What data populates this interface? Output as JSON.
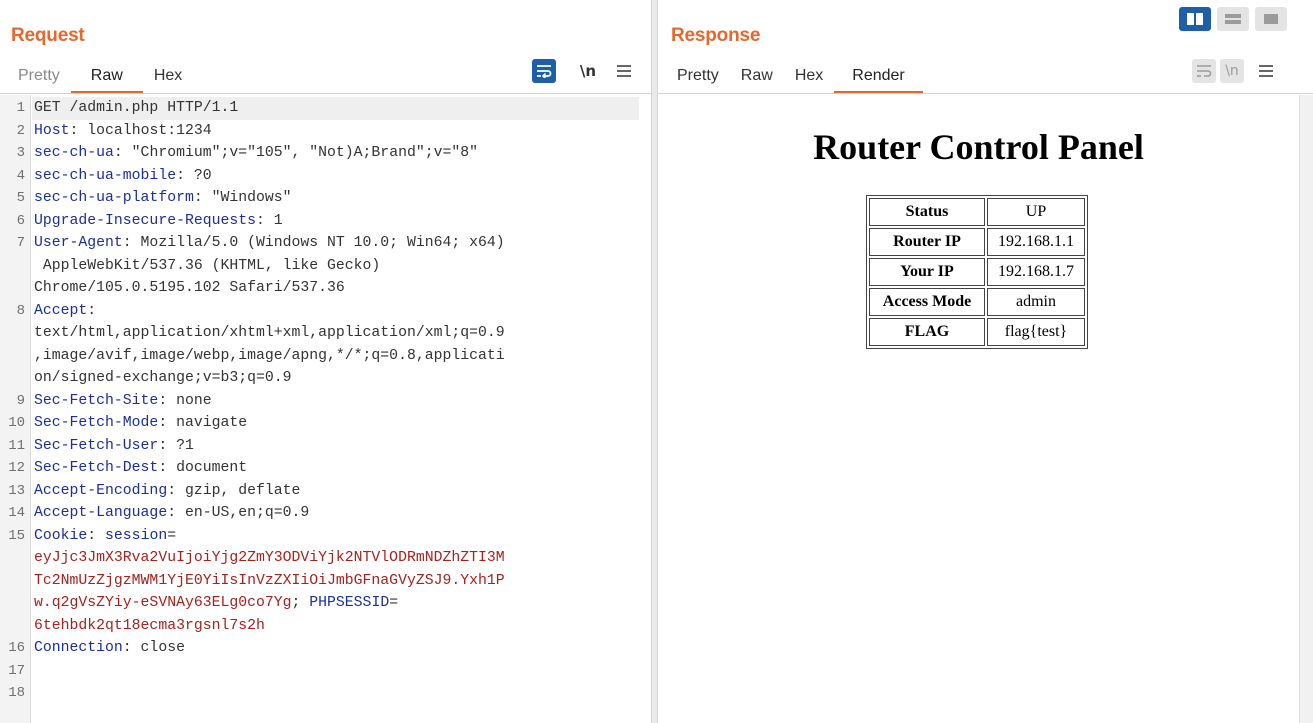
{
  "request": {
    "title": "Request",
    "tabs": [
      "Pretty",
      "Raw",
      "Hex"
    ],
    "active_tab": "Raw",
    "tools": {
      "wrap": "wrap-lines-icon",
      "newline": "\\n",
      "menu": "menu-icon"
    },
    "lines": [
      {
        "n": "1",
        "rows": [
          [
            [
              "p",
              "GET /admin.php HTTP/1.1"
            ]
          ]
        ],
        "current": true
      },
      {
        "n": "2",
        "rows": [
          [
            [
              "h",
              "Host"
            ],
            [
              "p",
              ": localhost:1234"
            ]
          ]
        ]
      },
      {
        "n": "3",
        "rows": [
          [
            [
              "h",
              "sec-ch-ua"
            ],
            [
              "p",
              ": \"Chromium\";v=\"105\", \"Not)A;Brand\";v=\"8\""
            ]
          ]
        ]
      },
      {
        "n": "4",
        "rows": [
          [
            [
              "h",
              "sec-ch-ua-mobile"
            ],
            [
              "p",
              ": ?0"
            ]
          ]
        ]
      },
      {
        "n": "5",
        "rows": [
          [
            [
              "h",
              "sec-ch-ua-platform"
            ],
            [
              "p",
              ": \"Windows\""
            ]
          ]
        ]
      },
      {
        "n": "6",
        "rows": [
          [
            [
              "h",
              "Upgrade-Insecure-Requests"
            ],
            [
              "p",
              ": 1"
            ]
          ]
        ]
      },
      {
        "n": "7",
        "rows": [
          [
            [
              "h",
              "User-Agent"
            ],
            [
              "p",
              ": Mozilla/5.0 (Windows NT 10.0; Win64; x64)"
            ]
          ],
          [
            [
              "p",
              " AppleWebKit/537.36 (KHTML, like Gecko)"
            ]
          ],
          [
            [
              "p",
              "Chrome/105.0.5195.102 Safari/537.36"
            ]
          ]
        ]
      },
      {
        "n": "8",
        "rows": [
          [
            [
              "h",
              "Accept"
            ],
            [
              "p",
              ":"
            ]
          ],
          [
            [
              "p",
              "text/html,application/xhtml+xml,application/xml;q=0.9"
            ]
          ],
          [
            [
              "p",
              ",image/avif,image/webp,image/apng,*/*;q=0.8,applicati"
            ]
          ],
          [
            [
              "p",
              "on/signed-exchange;v=b3;q=0.9"
            ]
          ]
        ]
      },
      {
        "n": "9",
        "rows": [
          [
            [
              "h",
              "Sec-Fetch-Site"
            ],
            [
              "p",
              ": none"
            ]
          ]
        ]
      },
      {
        "n": "10",
        "rows": [
          [
            [
              "h",
              "Sec-Fetch-Mode"
            ],
            [
              "p",
              ": navigate"
            ]
          ]
        ]
      },
      {
        "n": "11",
        "rows": [
          [
            [
              "h",
              "Sec-Fetch-User"
            ],
            [
              "p",
              ": ?1"
            ]
          ]
        ]
      },
      {
        "n": "12",
        "rows": [
          [
            [
              "h",
              "Sec-Fetch-Dest"
            ],
            [
              "p",
              ": document"
            ]
          ]
        ]
      },
      {
        "n": "13",
        "rows": [
          [
            [
              "h",
              "Accept-Encoding"
            ],
            [
              "p",
              ": gzip, deflate"
            ]
          ]
        ]
      },
      {
        "n": "14",
        "rows": [
          [
            [
              "h",
              "Accept-Language"
            ],
            [
              "p",
              ": en-US,en;q=0.9"
            ]
          ]
        ]
      },
      {
        "n": "15",
        "rows": [
          [
            [
              "h",
              "Cookie"
            ],
            [
              "p",
              ": "
            ],
            [
              "h",
              "session"
            ],
            [
              "p",
              "="
            ]
          ],
          [
            [
              "c",
              "eyJjc3JmX3Rva2VuIjoiYjg2ZmY3ODViYjk2NTVlODRmNDZhZTI3M"
            ]
          ],
          [
            [
              "c",
              "Tc2NmUzZjgzMWM1YjE0YiIsInVzZXIiOiJmbGFnaGVyZSJ9.Yxh1P"
            ]
          ],
          [
            [
              "c",
              "w.q2gVsZYiy-eSVNAy63ELg0co7Yg"
            ],
            [
              "p",
              "; "
            ],
            [
              "h",
              "PHPSESSID"
            ],
            [
              "p",
              "="
            ]
          ],
          [
            [
              "c",
              "6tehbdk2qt18ecma3rgsnl7s2h"
            ]
          ]
        ]
      },
      {
        "n": "16",
        "rows": [
          [
            [
              "h",
              "Connection"
            ],
            [
              "p",
              ": close"
            ]
          ]
        ]
      },
      {
        "n": "17",
        "rows": [
          [
            [
              "p",
              ""
            ]
          ]
        ]
      },
      {
        "n": "18",
        "rows": [
          [
            [
              "p",
              ""
            ]
          ]
        ]
      }
    ]
  },
  "response": {
    "title": "Response",
    "tabs": [
      "Pretty",
      "Raw",
      "Hex",
      "Render"
    ],
    "active_tab": "Render",
    "tools": {
      "wrap": "wrap-lines-icon",
      "newline": "\\n",
      "menu": "menu-icon"
    },
    "render": {
      "heading": "Router Control Panel",
      "rows": [
        {
          "key": "Status",
          "value": "UP"
        },
        {
          "key": "Router IP",
          "value": "192.168.1.1"
        },
        {
          "key": "Your IP",
          "value": "192.168.1.7"
        },
        {
          "key": "Access Mode",
          "value": "admin"
        },
        {
          "key": "FLAG",
          "value": "flag{test}"
        }
      ]
    }
  },
  "layout_modes": [
    "side-by-side",
    "stacked",
    "tabs"
  ],
  "active_layout": "side-by-side",
  "colors": {
    "accent": "#e8672d",
    "header_name": "#1a2e9c",
    "cookie_value": "#a8211c",
    "toggle_active": "#1f5fa8"
  }
}
